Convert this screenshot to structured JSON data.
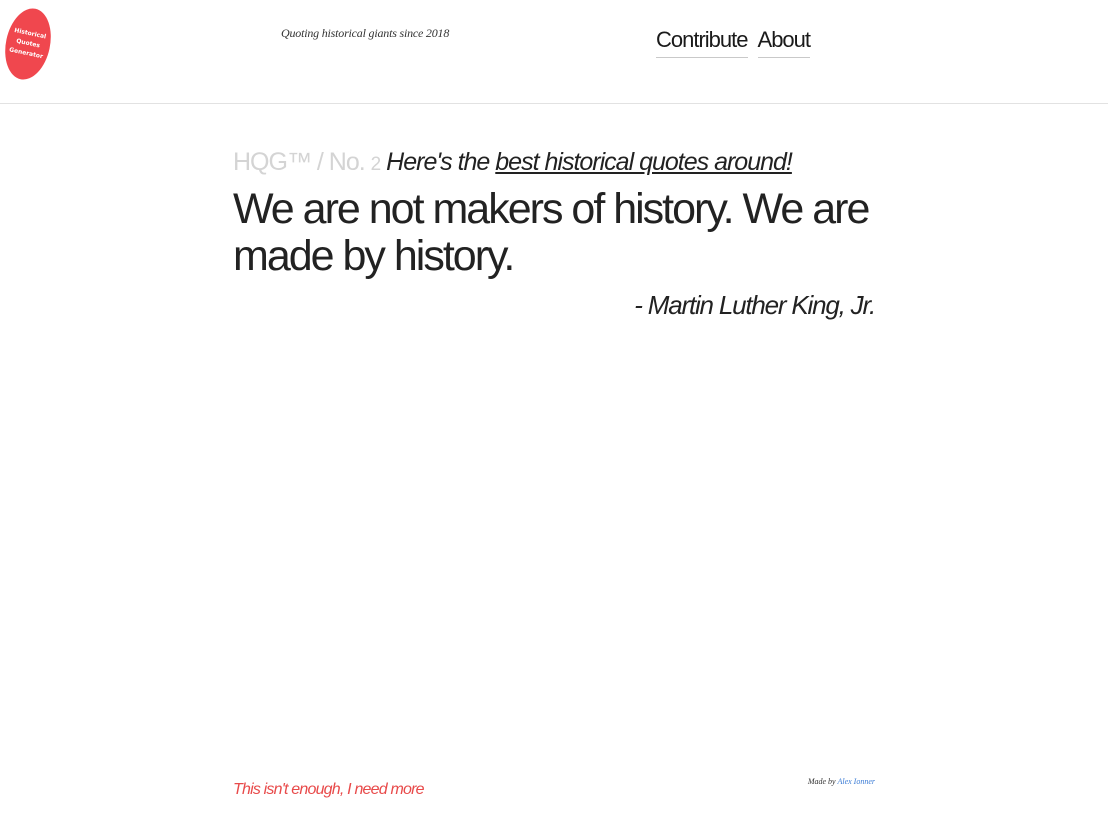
{
  "header": {
    "logo": {
      "line1": "Historical",
      "line2": "Quotes",
      "line3": "Generator",
      "color": "#f0474e"
    },
    "tagline": "Quoting historical giants since 2018",
    "nav": [
      {
        "label": "Contribute"
      },
      {
        "label": "About"
      }
    ]
  },
  "main": {
    "brand": "HQG™ / No.",
    "number": "2",
    "lead_prefix": "Here's the ",
    "lead_link": "best historical quotes around!",
    "quote": "We are not makers of history. We are made by history.",
    "author": "- Martin Luther King, Jr."
  },
  "footer": {
    "more_link": "This isn't enough, I need more",
    "credit_prefix": "Made by ",
    "credit_name": "Alex Ionner",
    "accent": "#e84a4a",
    "link_color": "#3a7bd5"
  }
}
